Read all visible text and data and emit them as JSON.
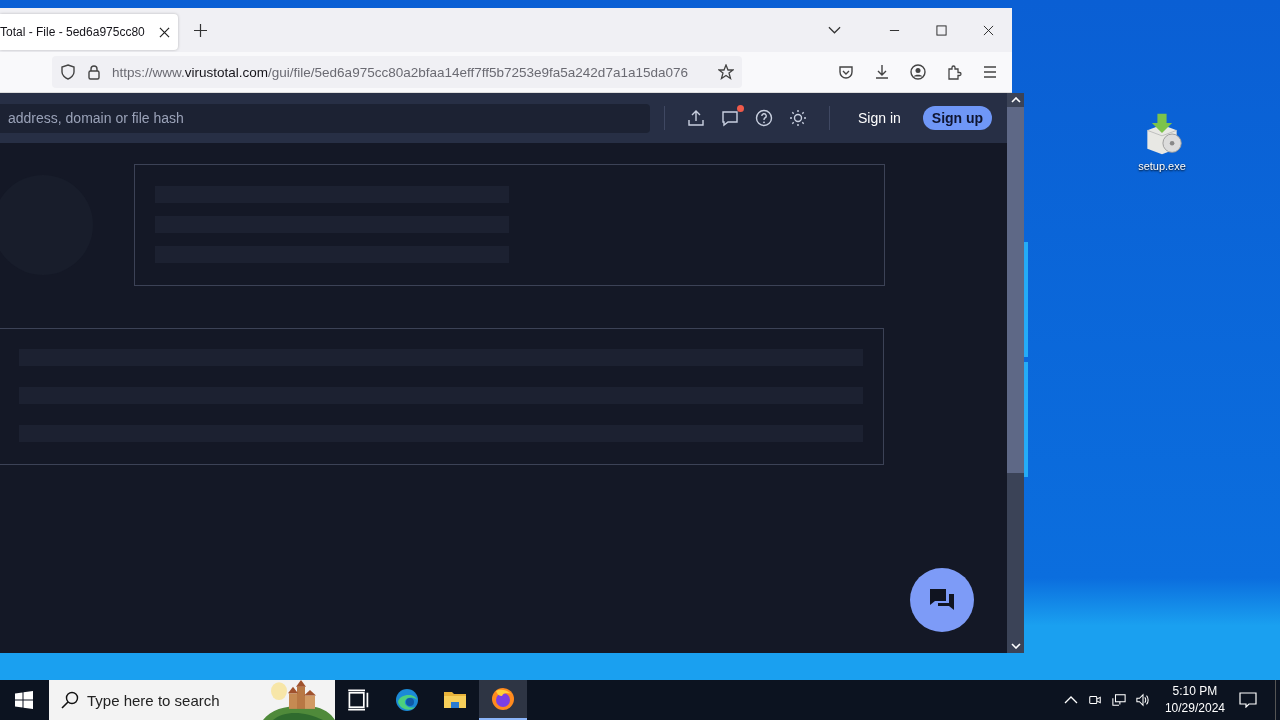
{
  "browser": {
    "tabs": [
      {
        "title": "Total - File - 5ed6a975cc80",
        "selected": true
      }
    ],
    "address": {
      "prefix": "https://www.",
      "host": "virustotal.com",
      "path": "/gui/file/5ed6a975cc80a2bfaa14eff7ff5b7253e9fa5a242d7a1a15da076"
    }
  },
  "site": {
    "search": {
      "placeholder": "address, domain or file hash"
    },
    "notification": true,
    "sign_in": "Sign in",
    "sign_up": "Sign up"
  },
  "desktop": {
    "icons": [
      {
        "label": "setup.exe"
      }
    ]
  },
  "taskbar": {
    "search": {
      "placeholder": "Type here to search"
    },
    "apps": [
      {
        "kind": "taskview",
        "selected": false
      },
      {
        "kind": "edge",
        "selected": false
      },
      {
        "kind": "explorer",
        "selected": false
      },
      {
        "kind": "firefox",
        "selected": true
      }
    ],
    "time": "5:10 PM",
    "date": "10/29/2024"
  }
}
